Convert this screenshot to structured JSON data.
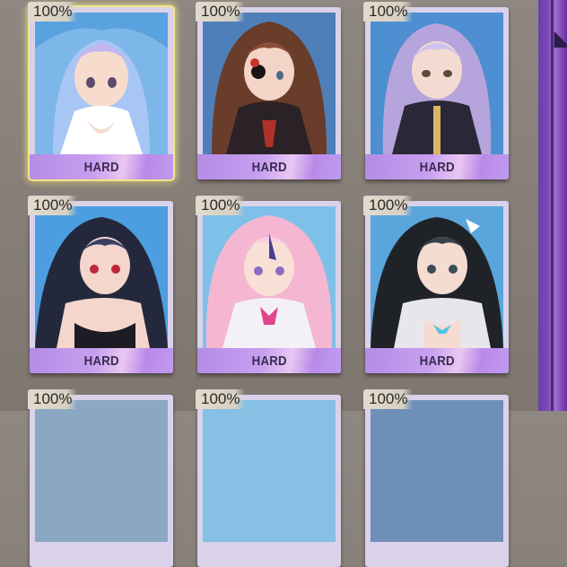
{
  "cards": [
    {
      "percent": "100%",
      "difficulty": "HARD",
      "hair": "#a8c6f4",
      "hair2": "#c4b6ef",
      "skin": "#f7dccd",
      "bg": "#5aa2df",
      "cloth": "#ffffff",
      "selected": true
    },
    {
      "percent": "100%",
      "difficulty": "HARD",
      "hair": "#6a3c2a",
      "hair2": "#8a5038",
      "skin": "#f4d4c6",
      "bg": "#4e7fb8",
      "cloth": "#2a2226",
      "selected": false
    },
    {
      "percent": "100%",
      "difficulty": "HARD",
      "hair": "#b6a4dc",
      "hair2": "#cfc1ee",
      "skin": "#f4dbd2",
      "bg": "#4d8fd0",
      "cloth": "#2a2838",
      "selected": false
    },
    {
      "percent": "100%",
      "difficulty": "HARD",
      "hair": "#24283c",
      "hair2": "#394063",
      "skin": "#f4d6cc",
      "bg": "#4c9ee0",
      "cloth": "#1d1c24",
      "selected": false
    },
    {
      "percent": "100%",
      "difficulty": "HARD",
      "hair": "#f5b6d1",
      "hair2": "#f8cfe2",
      "skin": "#f8e0d6",
      "bg": "#7ec0e8",
      "cloth": "#f3f1f6",
      "selected": false
    },
    {
      "percent": "100%",
      "difficulty": "HARD",
      "hair": "#1f2328",
      "hair2": "#38424a",
      "skin": "#f5dbd0",
      "bg": "#5aa5dc",
      "cloth": "#e8e6ea",
      "selected": false
    },
    {
      "percent": "100%",
      "selected": false
    },
    {
      "percent": "100%",
      "selected": false
    },
    {
      "percent": "100%",
      "selected": false
    }
  ],
  "icons": {
    "panel": "corner-mark-icon"
  }
}
